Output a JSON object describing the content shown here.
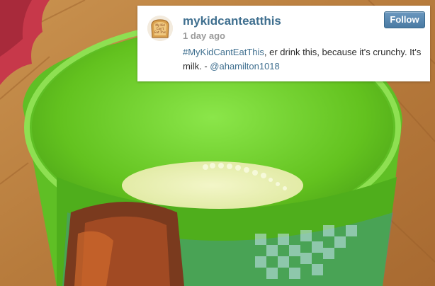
{
  "post": {
    "username": "mykidcanteatthis",
    "timestamp": "1 day ago",
    "follow_label": "Follow",
    "hashtag": "#MyKidCantEatThis",
    "caption_text": ", er drink this, because it's crunchy. It's milk. - ",
    "mention": "@ahamilton1018",
    "avatar_text": [
      "My Kid",
      "Can't",
      "Eat This"
    ]
  },
  "colors": {
    "link": "#3f6f8f",
    "follow_button": "#4a7aa3",
    "cup_green": "#6fd12b"
  }
}
